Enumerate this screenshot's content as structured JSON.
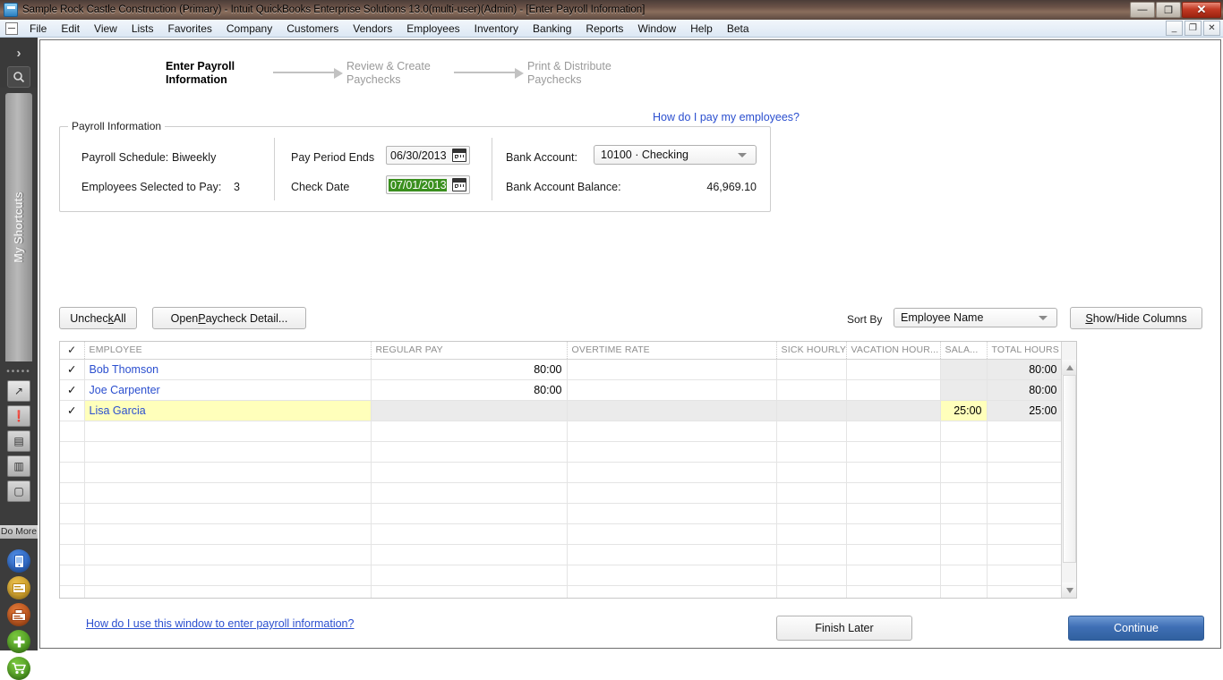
{
  "window": {
    "title": "Sample Rock Castle Construction (Primary)  - Intuit QuickBooks Enterprise Solutions 13.0(multi-user)(Admin) - [Enter Payroll Information]",
    "app_icon": "quickbooks-icon",
    "controls": {
      "minimize": "—",
      "restore": "❐",
      "close": "✕"
    },
    "mdi_controls": {
      "minimize": "_",
      "restore": "❐",
      "close": "✕"
    }
  },
  "menubar": {
    "system_icon": "system-menu-icon",
    "items": [
      "File",
      "Edit",
      "View",
      "Lists",
      "Favorites",
      "Company",
      "Customers",
      "Vendors",
      "Employees",
      "Inventory",
      "Banking",
      "Reports",
      "Window",
      "Help",
      "Beta"
    ]
  },
  "iconbar": {
    "chevron": "›",
    "search_icon": "search-icon",
    "shortcuts_label": "My Shortcuts",
    "dots": "•••••",
    "buttons": [
      {
        "name": "open-windows-icon",
        "glyph": "↗"
      },
      {
        "name": "alert-icon",
        "glyph": "❗"
      },
      {
        "name": "list-icon",
        "glyph": "▤"
      },
      {
        "name": "chart-icon",
        "glyph": "▥"
      },
      {
        "name": "window-icon",
        "glyph": "▢"
      }
    ],
    "do_more_label": "Do More",
    "circles": [
      {
        "name": "mobile-icon",
        "glyph": "▯",
        "color": "#2361c6"
      },
      {
        "name": "card-icon",
        "glyph": "▤",
        "color": "#d5a020"
      },
      {
        "name": "print-checks-icon",
        "glyph": "▤",
        "color": "#c1571b"
      },
      {
        "name": "add-icon",
        "glyph": "✚",
        "color": "#4e9c22"
      },
      {
        "name": "cart-icon",
        "glyph": "🛒",
        "color": "#4e9c22"
      }
    ]
  },
  "steps": [
    {
      "line1": "Enter Payroll",
      "line2": "Information",
      "state": "active"
    },
    {
      "line1": "Review & Create",
      "line2": "Paychecks",
      "state": "inactive"
    },
    {
      "line1": "Print & Distribute",
      "line2": "Paychecks",
      "state": "inactive"
    }
  ],
  "help_link": "How do I pay my employees?",
  "payroll_information": {
    "legend": "Payroll Information",
    "payroll_schedule_label": "Payroll Schedule:",
    "payroll_schedule_value": "Biweekly",
    "employees_selected_label": "Employees Selected to Pay:",
    "employees_selected_value": "3",
    "pay_period_ends_label": "Pay Period Ends",
    "pay_period_ends_value": "06/30/2013",
    "check_date_label": "Check Date",
    "check_date_value": "07/01/2013",
    "check_date_selected": true,
    "bank_account_label": "Bank Account:",
    "bank_account_value": "10100 · Checking",
    "bank_balance_label": "Bank Account Balance:",
    "bank_balance_value": "46,969.10",
    "calendar_icon": "calendar-icon",
    "dropdown_icon": "chevron-down-icon"
  },
  "toolbar": {
    "uncheck_all": {
      "pre": "Unchec",
      "mnemonic": "k",
      "post": " All"
    },
    "open_paycheck_detail": {
      "pre": "Open ",
      "mnemonic": "P",
      "post": "aycheck Detail..."
    },
    "sort_by_label": "Sort By",
    "sort_by_value": "Employee Name",
    "show_hide_columns": {
      "mnemonic": "S",
      "post": "how/Hide Columns"
    }
  },
  "grid": {
    "columns": [
      {
        "key": "check",
        "label": "✓",
        "align": "center"
      },
      {
        "key": "employee",
        "label": "EMPLOYEE",
        "align": "left"
      },
      {
        "key": "regular_pay",
        "label": "REGULAR PAY",
        "align": "left"
      },
      {
        "key": "overtime_rate",
        "label": "OVERTIME RATE",
        "align": "left"
      },
      {
        "key": "sick_hourly",
        "label": "SICK HOURLY",
        "align": "left"
      },
      {
        "key": "vacation_hourly",
        "label": "VACATION HOUR...",
        "align": "left"
      },
      {
        "key": "salary",
        "label": "SALA...",
        "align": "left"
      },
      {
        "key": "total_hours",
        "label": "TOTAL HOURS",
        "align": "left"
      }
    ],
    "rows": [
      {
        "checked": "✓",
        "employee": "Bob Thomson",
        "regular_pay": "80:00",
        "overtime_rate": "",
        "sick_hourly": "",
        "vacation_hourly": "",
        "salary": "",
        "total_hours": "80:00",
        "selected": false
      },
      {
        "checked": "✓",
        "employee": "Joe Carpenter",
        "regular_pay": "80:00",
        "overtime_rate": "",
        "sick_hourly": "",
        "vacation_hourly": "",
        "salary": "",
        "total_hours": "80:00",
        "selected": false
      },
      {
        "checked": "✓",
        "employee": "Lisa Garcia",
        "regular_pay": "",
        "overtime_rate": "",
        "sick_hourly": "",
        "vacation_hourly": "",
        "salary": "25:00",
        "total_hours": "25:00",
        "selected": true
      }
    ],
    "empty_row_count": 11,
    "scrollbar": {
      "up": "▲",
      "down": "▼"
    }
  },
  "footer": {
    "help_link": "How do I use this window to enter payroll information?",
    "finish_later": "Finish Later",
    "continue": "Continue"
  },
  "colors": {
    "link": "#2b4fcf",
    "selected_row": "#ffffbb",
    "date_selection": "#3a8f1e",
    "primary_button": "#3f6fb5"
  }
}
